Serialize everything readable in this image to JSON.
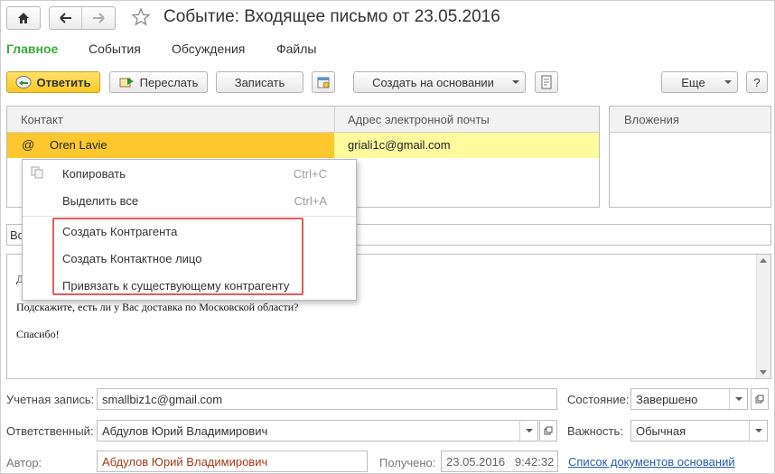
{
  "window": {
    "title": "Событие: Входящее письмо от 23.05.2016"
  },
  "tabs": [
    "Главное",
    "События",
    "Обсуждения",
    "Файлы"
  ],
  "toolbar": {
    "reply": "Ответить",
    "forward": "Переслать",
    "save": "Записать",
    "create_based": "Создать на основании",
    "more": "Еще",
    "help": "?"
  },
  "table": {
    "col_contact": "Контакт",
    "col_email": "Адрес электронной почты",
    "row": {
      "contact": "Oren Lavie",
      "email": "griali1c@gmail.com"
    }
  },
  "attachments": {
    "header": "Вложения"
  },
  "subject": {
    "value": "Во"
  },
  "body": {
    "line1": "Д",
    "line2": "Подскажите, есть ли у Вас доставка по Московской области?",
    "line3": "Спасибо!"
  },
  "context_menu": {
    "copy": "Копировать",
    "copy_sc": "Ctrl+C",
    "select_all": "Выделить все",
    "select_all_sc": "Ctrl+A",
    "create_counterparty": "Создать Контрагента",
    "create_contact": "Создать Контактное лицо",
    "link_existing": "Привязать к существующему контрагенту"
  },
  "form": {
    "account_label": "Учетная запись:",
    "account_value": "smallbiz1c@gmail.com",
    "state_label": "Состояние:",
    "state_value": "Завершено",
    "responsible_label": "Ответственный:",
    "responsible_value": "Абдулов Юрий Владимирович",
    "importance_label": "Важность:",
    "importance_value": "Обычная",
    "author_label": "Автор:",
    "author_value": "Абдулов Юрий Владимирович",
    "received_label": "Получено:",
    "received_value": "23.05.2016   9:42:32",
    "base_docs_link": "Список документов оснований"
  },
  "colors": {
    "accent_green": "#3aa93a",
    "row_selected": "#fcc82e",
    "highlight_box": "#e85a5a",
    "link": "#2a5db0"
  }
}
